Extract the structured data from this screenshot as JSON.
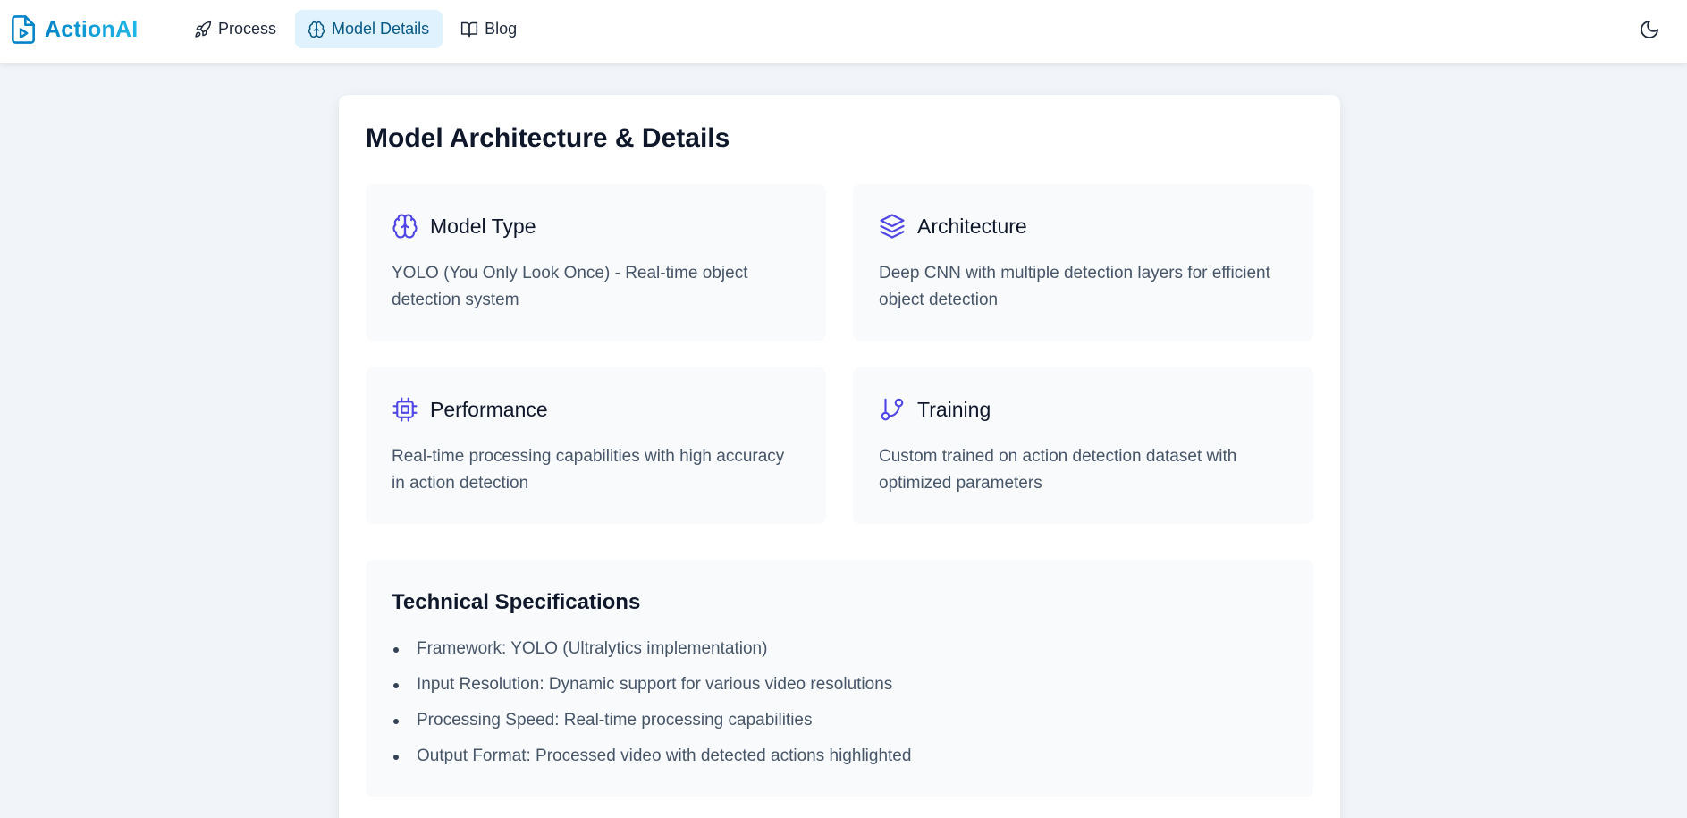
{
  "brand": {
    "name": "ActionAI",
    "icon": "file-video-icon"
  },
  "nav": {
    "items": [
      {
        "label": "Process",
        "icon": "rocket-icon",
        "active": false
      },
      {
        "label": "Model Details",
        "icon": "brain-icon",
        "active": true
      },
      {
        "label": "Blog",
        "icon": "book-open-icon",
        "active": false
      }
    ]
  },
  "theme_toggle": {
    "icon": "moon-icon"
  },
  "main": {
    "title": "Model Architecture & Details",
    "cards": [
      {
        "title": "Model Type",
        "icon": "brain-icon",
        "text": "YOLO (You Only Look Once) - Real-time object detection system"
      },
      {
        "title": "Architecture",
        "icon": "layers-icon",
        "text": "Deep CNN with multiple detection layers for efficient object detection"
      },
      {
        "title": "Performance",
        "icon": "cpu-icon",
        "text": "Real-time processing capabilities with high accuracy in action detection"
      },
      {
        "title": "Training",
        "icon": "git-branch-icon",
        "text": "Custom trained on action detection dataset with optimized parameters"
      }
    ],
    "specs": {
      "title": "Technical Specifications",
      "items": [
        "Framework: YOLO (Ultralytics implementation)",
        "Input Resolution: Dynamic support for various video resolutions",
        "Processing Speed: Real-time processing capabilities",
        "Output Format: Processed video with detected actions highlighted"
      ]
    }
  },
  "colors": {
    "brand": "#0ea5e9",
    "accent_icon": "#4f46e5",
    "active_nav_bg": "#e0f2fe",
    "page_bg": "#f1f5f9",
    "card_bg": "#f8fafc"
  }
}
